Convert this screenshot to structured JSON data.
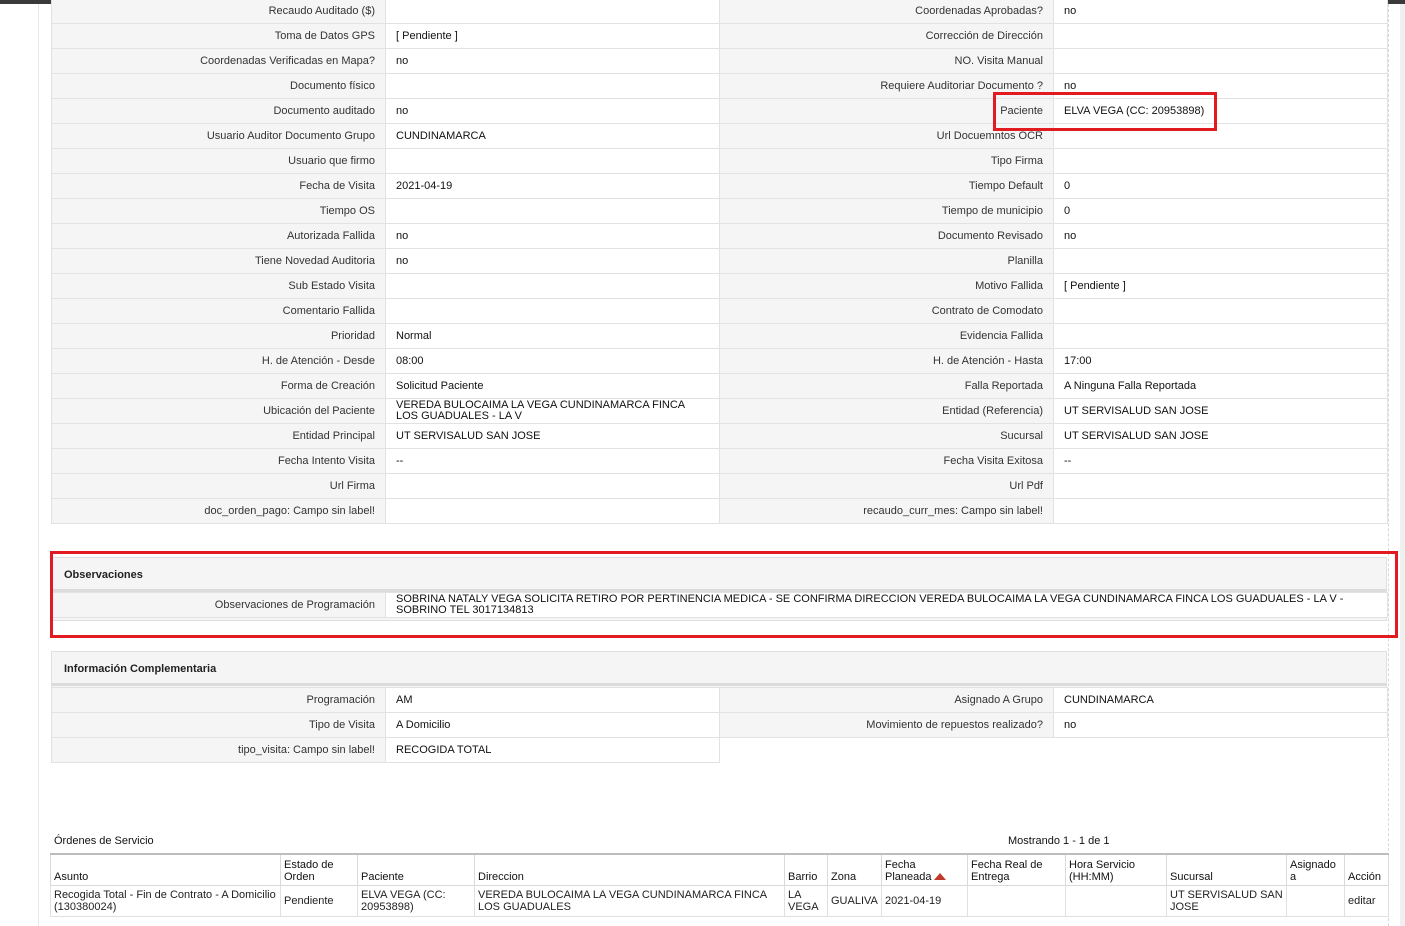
{
  "details": [
    [
      "Recaudo Auditado ($)",
      "",
      "Coordenadas Aprobadas?",
      "no"
    ],
    [
      "Toma de Datos GPS",
      "[ Pendiente ]",
      "Corrección de Dirección",
      ""
    ],
    [
      "Coordenadas Verificadas en Mapa?",
      "no",
      "NO. Visita Manual",
      ""
    ],
    [
      "Documento físico",
      "",
      "Requiere Auditoriar Documento ?",
      "no"
    ],
    [
      "Documento auditado",
      "no",
      "Paciente",
      "ELVA VEGA (CC: 20953898)"
    ],
    [
      "Usuario Auditor Documento Grupo",
      "CUNDINAMARCA",
      "Url Docuemntos OCR",
      ""
    ],
    [
      "Usuario que firmo",
      "",
      "Tipo Firma",
      ""
    ],
    [
      "Fecha de Visita",
      "2021-04-19",
      "Tiempo Default",
      "0"
    ],
    [
      "Tiempo OS",
      "",
      "Tiempo de municipio",
      "0"
    ],
    [
      "Autorizada Fallida",
      "no",
      "Documento Revisado",
      "no"
    ],
    [
      "Tiene Novedad Auditoria",
      "no",
      "Planilla",
      ""
    ],
    [
      "Sub Estado Visita",
      "",
      "Motivo Fallida",
      "[ Pendiente ]"
    ],
    [
      "Comentario Fallida",
      "",
      "Contrato de Comodato",
      ""
    ],
    [
      "Prioridad",
      "Normal",
      "Evidencia Fallida",
      ""
    ],
    [
      "H. de Atención - Desde",
      "08:00",
      "H. de Atención - Hasta",
      "17:00"
    ],
    [
      "Forma de Creación",
      "Solicitud Paciente",
      "Falla Reportada",
      "A Ninguna Falla Reportada"
    ],
    [
      "Ubicación del Paciente",
      "VEREDA BULOCAIMA LA VEGA CUNDINAMARCA FINCA LOS GUADUALES - LA V",
      "Entidad (Referencia)",
      "UT SERVISALUD SAN JOSE"
    ],
    [
      "Entidad Principal",
      "UT SERVISALUD SAN JOSE",
      "Sucursal",
      "UT SERVISALUD SAN JOSE"
    ],
    [
      "Fecha Intento Visita",
      "--",
      "Fecha Visita Exitosa",
      "--"
    ],
    [
      "Url Firma",
      "",
      "Url Pdf",
      ""
    ],
    [
      "doc_orden_pago: Campo sin label!",
      "",
      "recaudo_curr_mes: Campo sin label!",
      ""
    ]
  ],
  "observaciones": {
    "title": "Observaciones",
    "label": "Observaciones de Programación",
    "value": "SOBRINA NATALY VEGA SOLICITA RETIRO POR PERTINENCIA MEDICA - SE CONFIRMA DIRECCION VEREDA BULOCAIMA LA VEGA CUNDINAMARCA FINCA LOS GUADUALES - LA V - SOBRINO TEL 3017134813"
  },
  "complementaria": {
    "title": "Información Complementaria",
    "rows": [
      [
        "Programación",
        "AM",
        "Asignado A Grupo",
        "CUNDINAMARCA"
      ],
      [
        "Tipo de Visita",
        "A Domicilio",
        "Movimiento de repuestos realizado?",
        "no"
      ],
      [
        "tipo_visita: Campo sin label!",
        "RECOGIDA TOTAL"
      ]
    ]
  },
  "orders": {
    "title": "Órdenes de Servicio",
    "count": "Mostrando 1 - 1 de 1",
    "columns": [
      "Asunto",
      "Estado de Orden",
      "Paciente",
      "Direccion",
      "Barrio",
      "Zona",
      "Fecha Planeada",
      "Fecha Real de Entrega",
      "Hora Servicio (HH:MM)",
      "Sucursal",
      "Asignado a",
      "Acción"
    ],
    "rows": [
      [
        "Recogida Total - Fin de Contrato - A Domicilio (130380024)",
        "Pendiente",
        "ELVA VEGA (CC: 20953898)",
        "VEREDA BULOCAIMA LA VEGA CUNDINAMARCA FINCA LOS GUADUALES",
        "LA VEGA",
        "GUALIVA",
        "2021-04-19",
        "",
        "",
        "UT SERVISALUD SAN JOSE",
        "",
        "editar"
      ]
    ]
  },
  "colors": {
    "highlight": "#e21a22",
    "label_bg": "#f5f5f5",
    "sort_arrow": "#c0392b"
  }
}
